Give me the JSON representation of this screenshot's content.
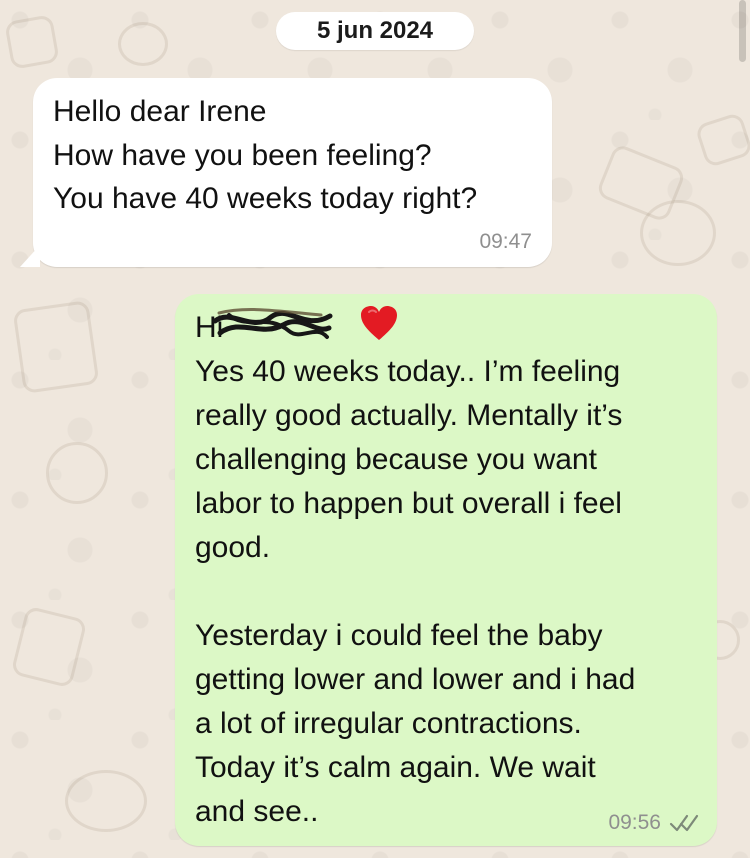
{
  "chat": {
    "date": "5 jun 2024",
    "incoming": {
      "lines": [
        "Hello dear Irene",
        "How have you been feeling?",
        "You have 40 weeks today right?"
      ],
      "time": "09:47"
    },
    "outgoing": {
      "greeting": "Hi",
      "lines": [
        "Yes 40 weeks today.. I’m feeling",
        "really good actually. Mentally it’s",
        "challenging because you want",
        "labor to happen but overall i feel",
        "good.",
        "",
        "Yesterday i could feel the baby",
        "getting lower and lower and i had",
        "a lot of irregular contractions.",
        "Today it’s calm again. We wait",
        "and see.."
      ],
      "time": "09:56",
      "status_icon": "double-check-icon"
    }
  },
  "colors": {
    "background": "#efe7dd",
    "incoming_bubble": "#ffffff",
    "outgoing_bubble": "#dcf8c6",
    "text": "#111111",
    "timestamp": "#8f8f8f",
    "heart": "#e31b23"
  }
}
